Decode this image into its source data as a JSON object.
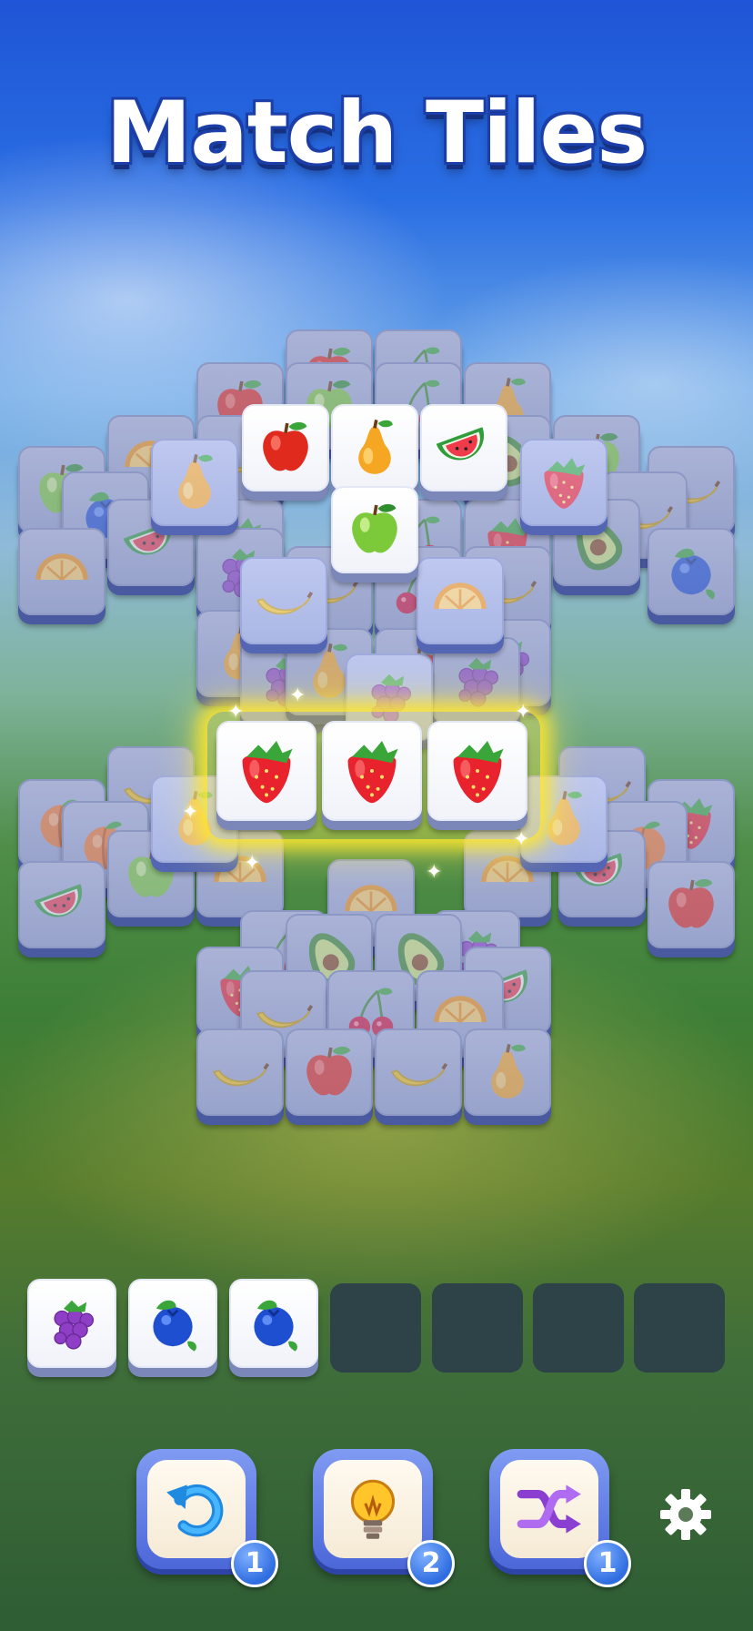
{
  "header": {
    "title": "Match Tiles"
  },
  "tray": {
    "filled": [
      "grapes",
      "blueberry",
      "blueberry"
    ],
    "capacity": 7
  },
  "boosters": [
    {
      "name": "undo",
      "icon": "undo-arrow-icon",
      "count": "1"
    },
    {
      "name": "hint",
      "icon": "lightbulb-icon",
      "count": "2"
    },
    {
      "name": "shuffle",
      "icon": "shuffle-icon",
      "count": "1"
    }
  ],
  "settings": {
    "icon": "gear-icon"
  },
  "matched_row": [
    "strawberry",
    "strawberry",
    "strawberry"
  ],
  "colors": {
    "tile_face": "#dfe6f7",
    "tile_side": "#5a6cb5",
    "highlight": "#ffe83c",
    "badge": "#2f6de0"
  }
}
